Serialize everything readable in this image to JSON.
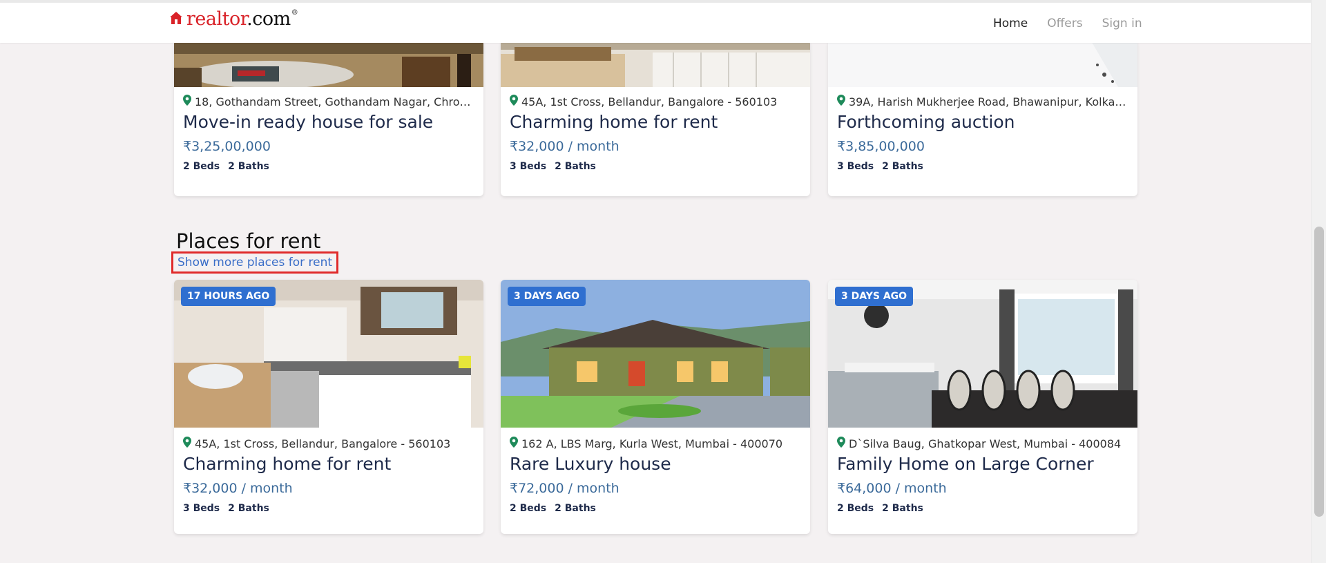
{
  "header": {
    "brand": {
      "name_part1": "realtor",
      "name_part2": ".com",
      "reg": "®"
    },
    "nav": [
      {
        "label": "Home",
        "active": true
      },
      {
        "label": "Offers",
        "active": false
      },
      {
        "label": "Sign in",
        "active": false
      }
    ]
  },
  "top_row": [
    {
      "address": "18, Gothandam Street, Gothandam Nagar, Chrom...",
      "title": "Move-in ready house for sale",
      "price": "₹3,25,00,000",
      "beds": "2 Beds",
      "baths": "2 Baths"
    },
    {
      "address": "45A, 1st Cross, Bellandur, Bangalore - 560103",
      "title": "Charming home for rent",
      "price": "₹32,000 / month",
      "beds": "3 Beds",
      "baths": "2 Baths"
    },
    {
      "address": "39A, Harish Mukherjee Road, Bhawanipur, Kolkat...",
      "title": "Forthcoming auction",
      "price": "₹3,85,00,000",
      "beds": "3 Beds",
      "baths": "2 Baths"
    }
  ],
  "rent_section": {
    "title": "Places for rent",
    "show_more": "Show more places for rent",
    "cards": [
      {
        "badge": "17 HOURS AGO",
        "address": "45A, 1st Cross, Bellandur, Bangalore - 560103",
        "title": "Charming home for rent",
        "price": "₹32,000 / month",
        "beds": "3 Beds",
        "baths": "2 Baths"
      },
      {
        "badge": "3 DAYS AGO",
        "address": "162 A, LBS Marg, Kurla West, Mumbai - 400070",
        "title": "Rare Luxury house",
        "price": "₹72,000 / month",
        "beds": "2 Beds",
        "baths": "2 Baths"
      },
      {
        "badge": "3 DAYS AGO",
        "address": "D`Silva Baug, Ghatkopar West, Mumbai - 400084",
        "title": "Family Home on Large Corner",
        "price": "₹64,000 / month",
        "beds": "2 Beds",
        "baths": "2 Baths"
      }
    ]
  },
  "icons": {
    "pin": "map-pin-icon",
    "logo_house": "house-logo-icon"
  },
  "colors": {
    "brand_red": "#d92228",
    "pin_green": "#1e8a5a",
    "badge_blue": "#2f6fd0",
    "price_blue": "#3b6a9a",
    "link_blue": "#3a6ec8",
    "highlight_red": "#e02a2a"
  }
}
